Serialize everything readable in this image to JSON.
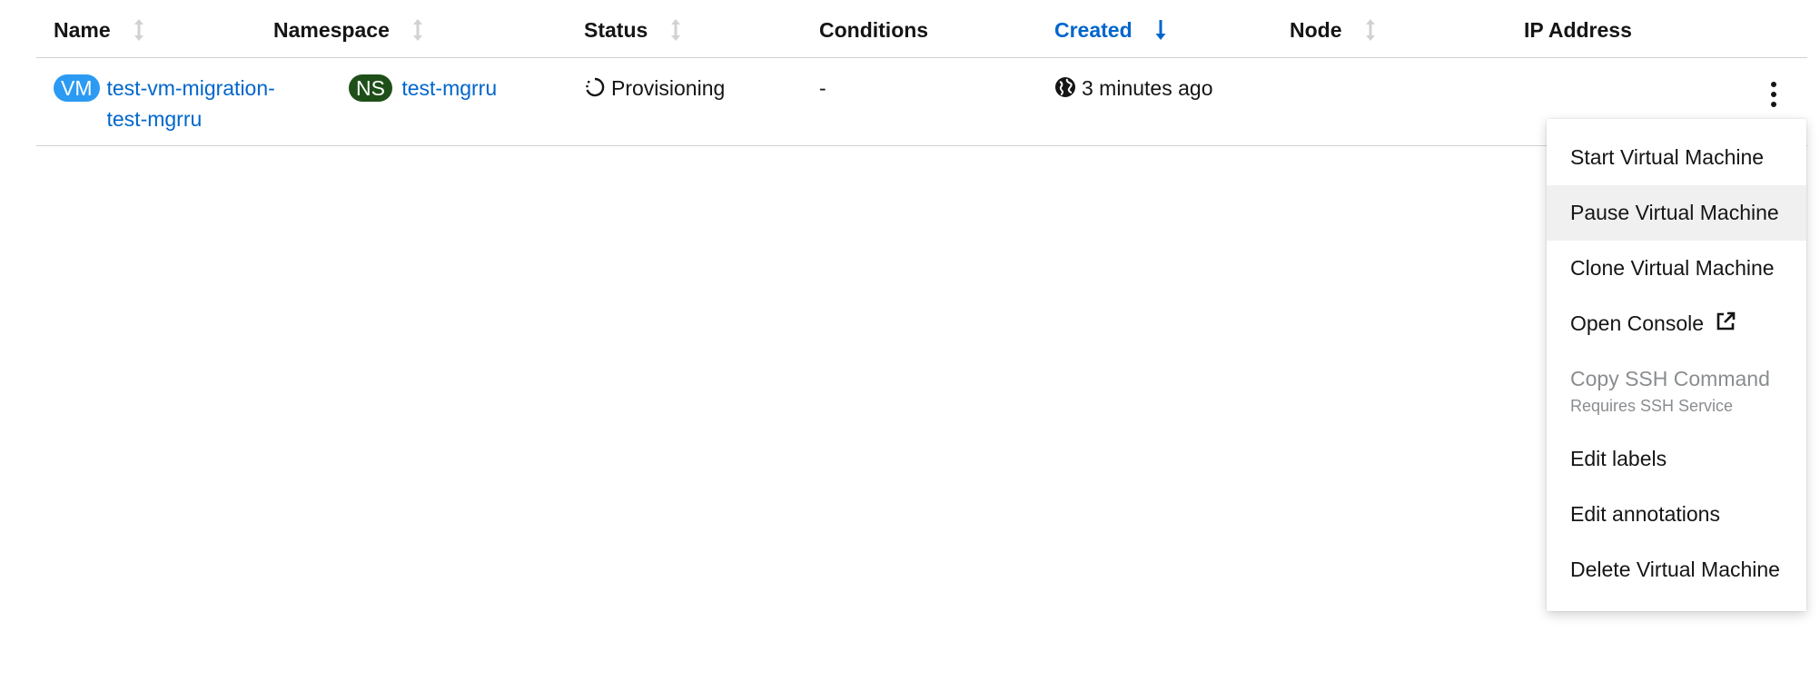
{
  "table": {
    "columns": [
      {
        "label": "Name",
        "sortable": true,
        "active": false
      },
      {
        "label": "Namespace",
        "sortable": true,
        "active": false
      },
      {
        "label": "Status",
        "sortable": true,
        "active": false
      },
      {
        "label": "Conditions",
        "sortable": false,
        "active": false
      },
      {
        "label": "Created",
        "sortable": true,
        "active": true,
        "sort_direction": "desc"
      },
      {
        "label": "Node",
        "sortable": true,
        "active": false
      },
      {
        "label": "IP Address",
        "sortable": false,
        "active": false
      }
    ],
    "row": {
      "name_badge": "VM",
      "name_line1": "test-vm-migration-",
      "name_line2": "test-mgrru",
      "namespace_badge": "NS",
      "namespace": "test-mgrru",
      "status": "Provisioning",
      "conditions": "-",
      "created": "3 minutes ago",
      "node": "",
      "ip_address": ""
    }
  },
  "menu": {
    "items": [
      {
        "label": "Start Virtual Machine"
      },
      {
        "label": "Pause Virtual Machine",
        "hovered": true
      },
      {
        "label": "Clone Virtual Machine"
      },
      {
        "label": "Open Console",
        "icon": "external-link-icon"
      },
      {
        "label": "Copy SSH Command",
        "description": "Requires SSH Service",
        "disabled": true
      },
      {
        "label": "Edit labels"
      },
      {
        "label": "Edit annotations"
      },
      {
        "label": "Delete Virtual Machine"
      }
    ]
  },
  "colors": {
    "link": "#0066cc",
    "vm_badge": "#2b9af3",
    "ns_badge": "#1e4f18",
    "hover_bg": "#f0f0f0",
    "disabled_text": "#8a8d90"
  }
}
